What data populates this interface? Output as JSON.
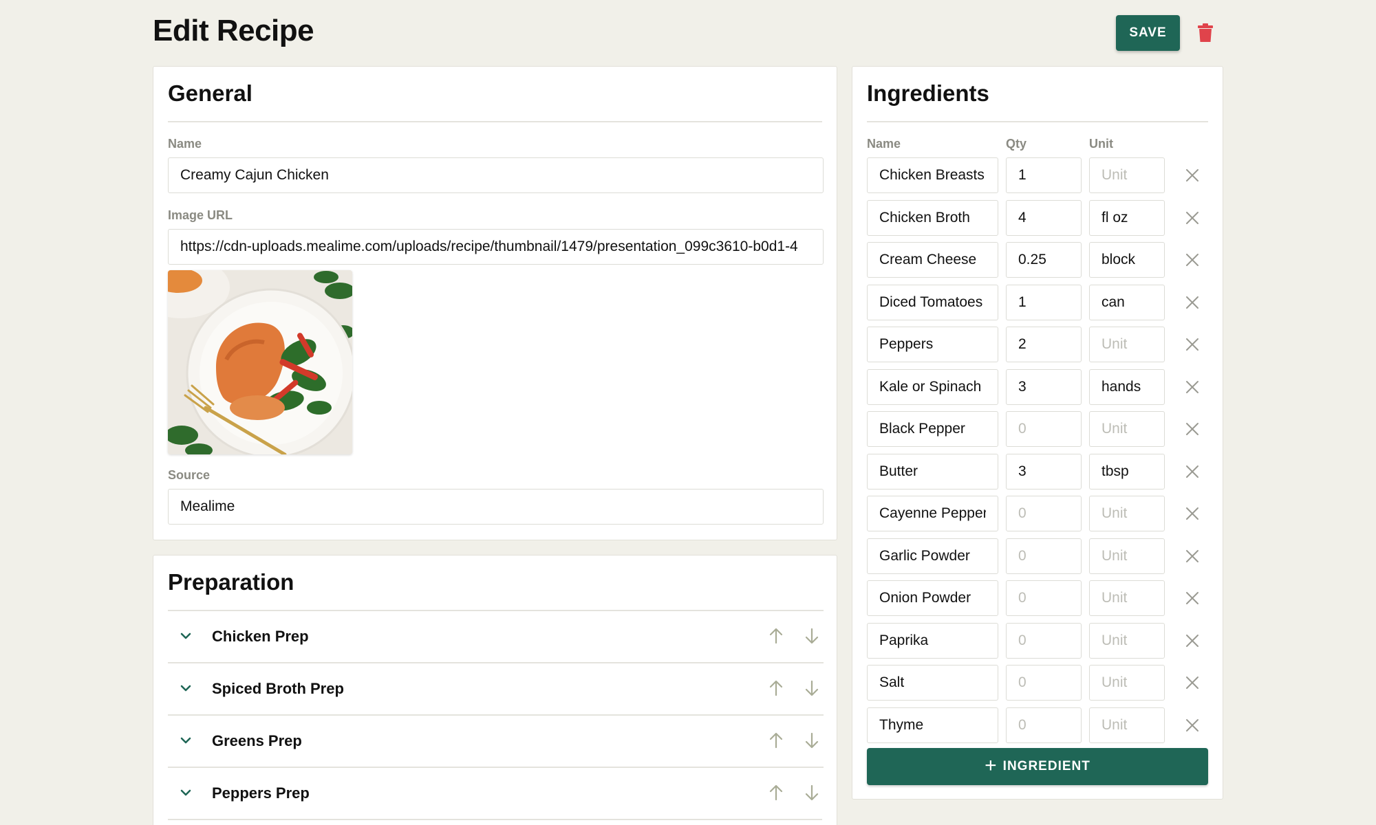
{
  "header": {
    "title": "Edit Recipe",
    "save_label": "SAVE",
    "delete_icon": "trash-icon",
    "accent_color": "#1f6656",
    "danger_color": "#e0434b"
  },
  "general": {
    "title": "General",
    "name_label": "Name",
    "name_value": "Creamy Cajun Chicken",
    "image_url_label": "Image URL",
    "image_url_value": "https://cdn-uploads.mealime.com/uploads/recipe/thumbnail/1479/presentation_099c3610-b0d1-4",
    "image_alt": "recipe-photo",
    "source_label": "Source",
    "source_value": "Mealime"
  },
  "preparation": {
    "title": "Preparation",
    "items": [
      {
        "label": "Chicken Prep"
      },
      {
        "label": "Spiced Broth Prep"
      },
      {
        "label": "Greens Prep"
      },
      {
        "label": "Peppers Prep"
      }
    ]
  },
  "ingredients": {
    "title": "Ingredients",
    "col_name": "Name",
    "col_qty": "Qty",
    "col_unit": "Unit",
    "qty_placeholder": "0",
    "unit_placeholder": "Unit",
    "add_label": "INGREDIENT",
    "items": [
      {
        "name": "Chicken Breasts",
        "qty": "1",
        "unit": ""
      },
      {
        "name": "Chicken Broth",
        "qty": "4",
        "unit": "fl oz"
      },
      {
        "name": "Cream Cheese",
        "qty": "0.25",
        "unit": "block"
      },
      {
        "name": "Diced Tomatoes",
        "qty": "1",
        "unit": "can"
      },
      {
        "name": "Peppers",
        "qty": "2",
        "unit": ""
      },
      {
        "name": "Kale or Spinach",
        "qty": "3",
        "unit": "hands"
      },
      {
        "name": "Black Pepper",
        "qty": "",
        "unit": ""
      },
      {
        "name": "Butter",
        "qty": "3",
        "unit": "tbsp"
      },
      {
        "name": "Cayenne Pepper",
        "qty": "",
        "unit": ""
      },
      {
        "name": "Garlic Powder",
        "qty": "",
        "unit": ""
      },
      {
        "name": "Onion Powder",
        "qty": "",
        "unit": ""
      },
      {
        "name": "Paprika",
        "qty": "",
        "unit": ""
      },
      {
        "name": "Salt",
        "qty": "",
        "unit": ""
      },
      {
        "name": "Thyme",
        "qty": "",
        "unit": ""
      }
    ]
  }
}
